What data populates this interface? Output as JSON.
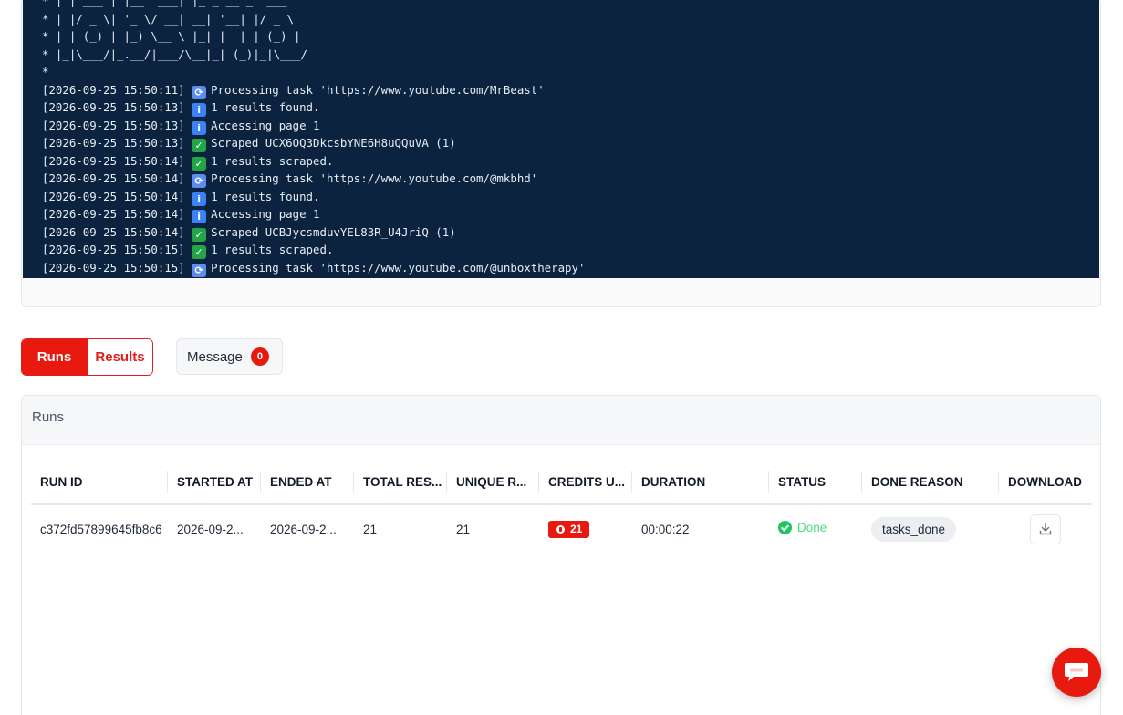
{
  "log": {
    "ascii_art": [
      "* | | ___ | |__  ___| |_ _ __ _  ___",
      "* | |/ _ \\| '_ \\/ __| __| '__| |/ _ \\",
      "* | | (_) | |_) \\__ \\ |_| |  | | (_) |",
      "* |_|\\___/|_.__/|___/\\__|_| (_)|_|\\___/",
      "*"
    ],
    "entries": [
      {
        "time": "[2026-09-25 15:50:11]",
        "icon": "processing-icon",
        "text": "Processing task 'https://www.youtube.com/MrBeast'"
      },
      {
        "time": "[2026-09-25 15:50:13]",
        "icon": "info-icon",
        "text": "1 results found."
      },
      {
        "time": "[2026-09-25 15:50:13]",
        "icon": "info-icon",
        "text": "Accessing page 1"
      },
      {
        "time": "[2026-09-25 15:50:13]",
        "icon": "check-icon",
        "text": "Scraped UCX6OQ3DkcsbYNE6H8uQQuVA (1)"
      },
      {
        "time": "[2026-09-25 15:50:14]",
        "icon": "check-icon",
        "text": "1 results scraped."
      },
      {
        "time": "[2026-09-25 15:50:14]",
        "icon": "processing-icon",
        "text": "Processing task 'https://www.youtube.com/@mkbhd'"
      },
      {
        "time": "[2026-09-25 15:50:14]",
        "icon": "info-icon",
        "text": "1 results found."
      },
      {
        "time": "[2026-09-25 15:50:14]",
        "icon": "info-icon",
        "text": "Accessing page 1"
      },
      {
        "time": "[2026-09-25 15:50:14]",
        "icon": "check-icon",
        "text": "Scraped UCBJycsmduvYEL83R_U4JriQ (1)"
      },
      {
        "time": "[2026-09-25 15:50:15]",
        "icon": "check-icon",
        "text": "1 results scraped."
      },
      {
        "time": "[2026-09-25 15:50:15]",
        "icon": "processing-icon",
        "text": "Processing task 'https://www.youtube.com/@unboxtherapy'"
      }
    ]
  },
  "tabs": {
    "runs": "Runs",
    "results": "Results",
    "message_label": "Message",
    "message_count": "0"
  },
  "runs_panel": {
    "title": "Runs",
    "columns": [
      "RUN ID",
      "STARTED AT",
      "ENDED AT",
      "TOTAL RES...",
      "UNIQUE R...",
      "CREDITS U...",
      "DURATION",
      "STATUS",
      "DONE REASON",
      "DOWNLOAD"
    ],
    "rows": [
      {
        "run_id": "c372fd57899645fb8c6",
        "started_at": "2026-09-2...",
        "ended_at": "2026-09-2...",
        "total_results": "21",
        "unique_results": "21",
        "credits_used": "21",
        "duration": "00:00:22",
        "status": "Done",
        "done_reason": "tasks_done"
      }
    ]
  },
  "colors": {
    "brand_red": "#e8190f",
    "terminal_bg": "#0c2340",
    "status_green": "#22c55e"
  },
  "icons": {
    "download": "download-icon",
    "chat": "chat-icon",
    "credits": "coin-icon",
    "status": "check-circle-icon"
  }
}
